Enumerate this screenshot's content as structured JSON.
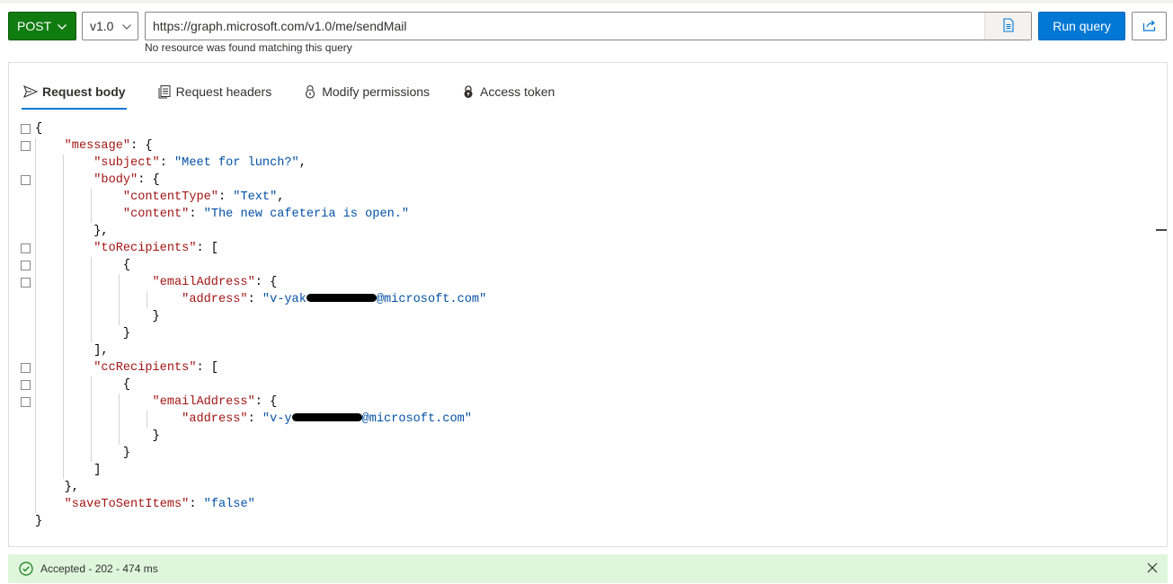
{
  "query": {
    "method": "POST",
    "version": "v1.0",
    "url": "https://graph.microsoft.com/v1.0/me/sendMail",
    "hint": "No resource was found matching this query",
    "run_label": "Run query"
  },
  "tabs": [
    {
      "label": "Request body",
      "icon": "send-icon",
      "active": true
    },
    {
      "label": "Request headers",
      "icon": "headers-icon",
      "active": false
    },
    {
      "label": "Modify permissions",
      "icon": "permissions-icon",
      "active": false
    },
    {
      "label": "Access token",
      "icon": "lock-icon",
      "active": false
    }
  ],
  "body": {
    "k_message": "\"message\"",
    "k_subject": "\"subject\"",
    "v_subject": "\"Meet for lunch?\"",
    "k_body": "\"body\"",
    "k_contentType": "\"contentType\"",
    "v_contentType": "\"Text\"",
    "k_content": "\"content\"",
    "v_content": "\"The new cafeteria is open.\"",
    "k_toRecipients": "\"toRecipients\"",
    "k_emailAddress": "\"emailAddress\"",
    "k_address": "\"address\"",
    "v_to_address_start": "\"v-yak",
    "v_to_address_end": "@microsoft.com\"",
    "k_ccRecipients": "\"ccRecipients\"",
    "v_cc_address_start": "\"v-y",
    "v_cc_address_end": "@microsoft.com\"",
    "k_saveToSentItems": "\"saveToSentItems\"",
    "v_saveToSentItems": "\"false\""
  },
  "status": {
    "text": "Accepted - 202 - 474 ms",
    "color": "#dff6dd"
  },
  "colors": {
    "method_green": "#107c10",
    "run_blue": "#0078d4",
    "json_key": "#a31515",
    "json_string": "#0451a5"
  }
}
